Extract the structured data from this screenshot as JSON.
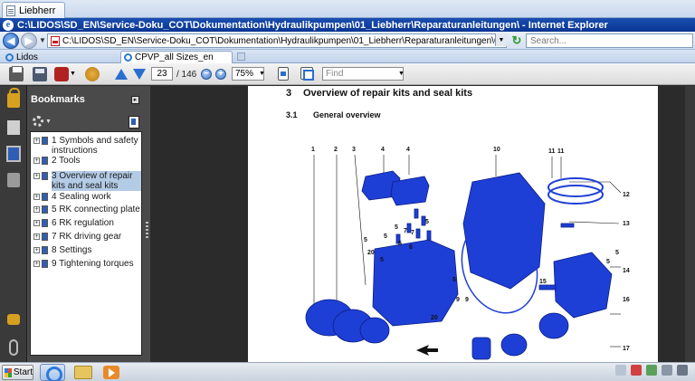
{
  "browser": {
    "tab_title": "Liebherr",
    "window_title": "C:\\LIDOS\\SD_EN\\Service-Doku_COT\\Dokumentation\\Hydraulikpumpen\\01_Liebherr\\Reparaturanleitungen\\ - Internet Explorer",
    "address": "C:\\LIDOS\\SD_EN\\Service-Doku_COT\\Dokumentation\\Hydraulikpumpen\\01_Liebherr\\Reparaturanleitungen\\CPVP_all Sizes_en.pdf",
    "search_placeholder": "Search...",
    "tabs": [
      {
        "label": "Lidos"
      },
      {
        "label": "CPVP_all Sizes_en"
      }
    ]
  },
  "pdf_toolbar": {
    "current_page": "23",
    "page_total": "/ 146",
    "zoom": "75%",
    "find_placeholder": "Find"
  },
  "bookmarks": {
    "title": "Bookmarks",
    "items": [
      {
        "label": "1 Symbols and safety instructions",
        "selected": false
      },
      {
        "label": "2 Tools",
        "selected": false
      },
      {
        "label": "3 Overview of repair kits and seal kits",
        "selected": true
      },
      {
        "label": "4 Sealing work",
        "selected": false
      },
      {
        "label": "5 RK connecting plate",
        "selected": false
      },
      {
        "label": "6 RK regulation",
        "selected": false
      },
      {
        "label": "7 RK driving gear",
        "selected": false
      },
      {
        "label": "8 Settings",
        "selected": false
      },
      {
        "label": "9 Tightening torques",
        "selected": false
      }
    ]
  },
  "document": {
    "section_number": "3",
    "section_title": "Overview of repair kits and seal kits",
    "subsection_number": "3.1",
    "subsection_title": "General overview",
    "callouts": [
      "1",
      "2",
      "3",
      "4",
      "4",
      "10",
      "11",
      "11",
      "12",
      "13",
      "5",
      "5",
      "5",
      "7",
      "7",
      "5",
      "5",
      "6",
      "20",
      "5",
      "5",
      "15",
      "5",
      "14",
      "16",
      "17",
      "20",
      "9",
      "9",
      "5"
    ]
  },
  "taskbar": {
    "start_label": "Start"
  },
  "colors": {
    "title_bar": "#0b3592",
    "part_blue": "#1e3fd6",
    "selection": "#b4cbe6"
  }
}
